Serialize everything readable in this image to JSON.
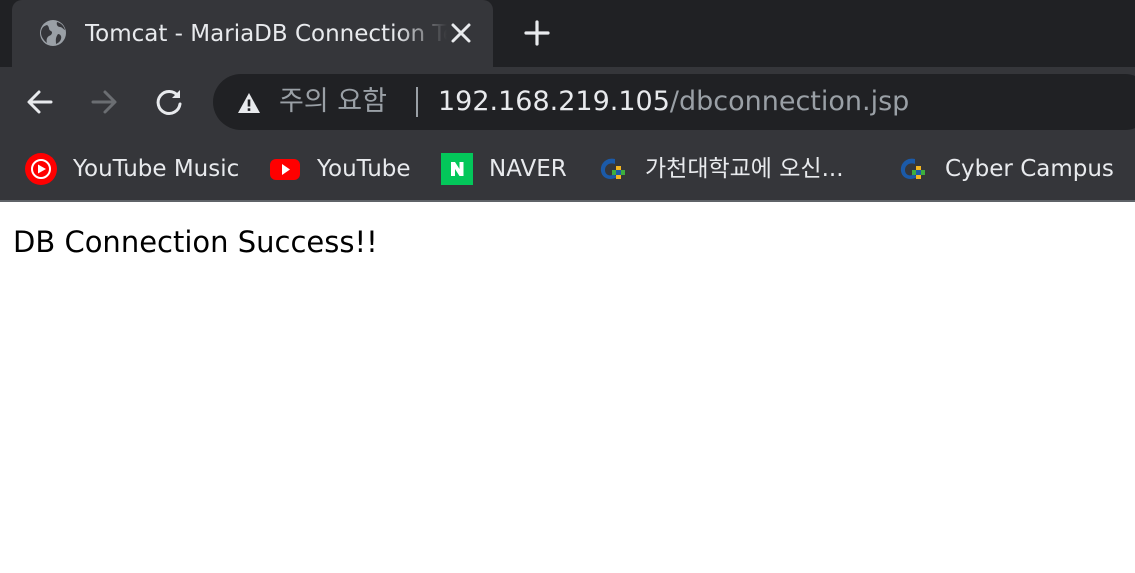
{
  "tab": {
    "title": "Tomcat - MariaDB Connection Test"
  },
  "omnibox": {
    "security_label": "주의 요함",
    "url_host": "192.168.219.105",
    "url_path": "/dbconnection.jsp"
  },
  "bookmarks": [
    {
      "label": "YouTube Music",
      "icon": "youtube-music-icon"
    },
    {
      "label": "YouTube",
      "icon": "youtube-icon"
    },
    {
      "label": "NAVER",
      "icon": "naver-icon"
    },
    {
      "label": "가천대학교에 오신...",
      "icon": "gachon-icon"
    },
    {
      "label": "Cyber Campus",
      "icon": "gachon-icon"
    }
  ],
  "page": {
    "message": "DB Connection Success!!"
  },
  "colors": {
    "frame": "#202124",
    "toolbar": "#35363a",
    "text": "#e8eaed",
    "muted": "#9aa0a6"
  }
}
